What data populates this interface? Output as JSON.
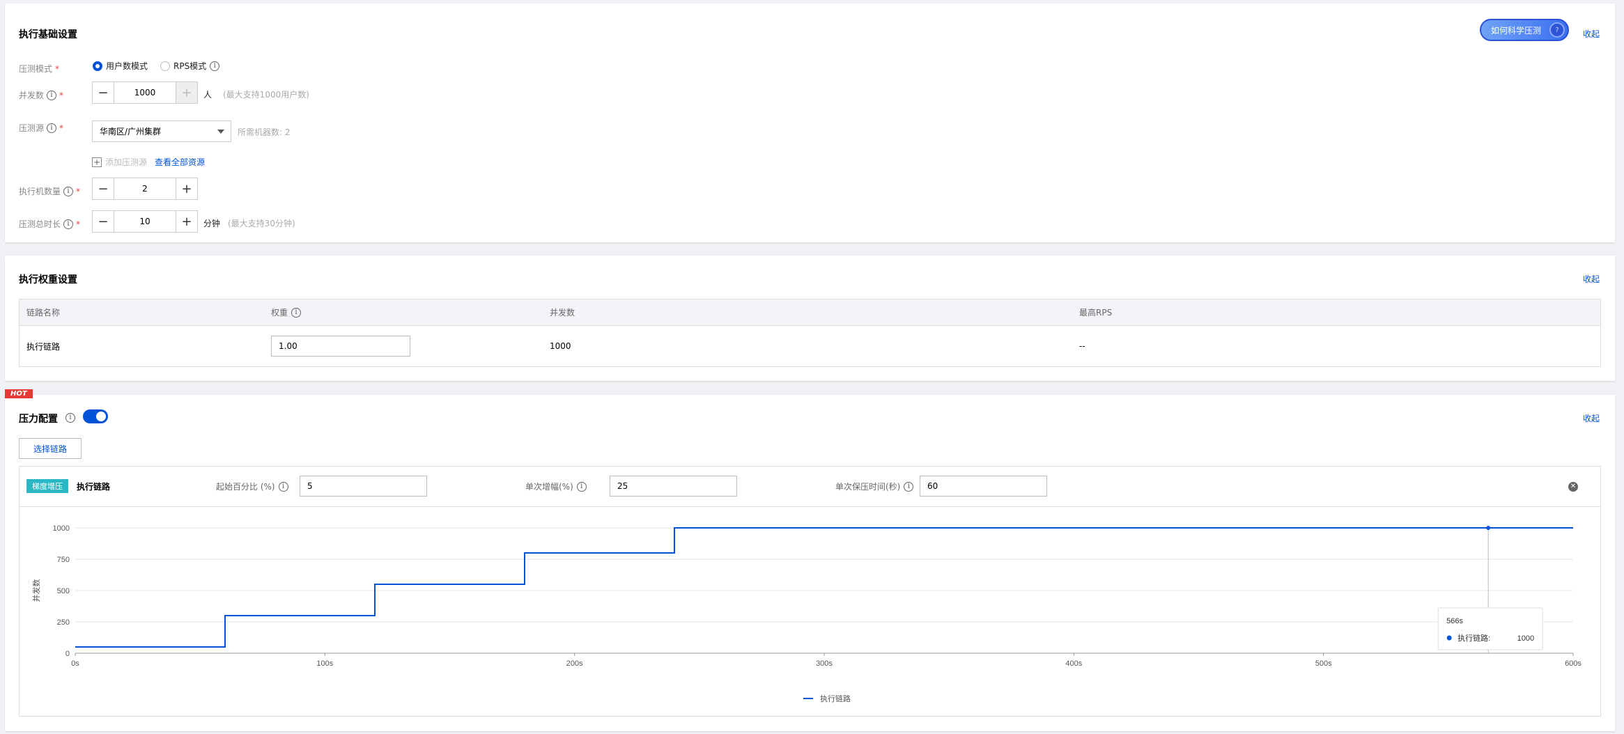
{
  "basic": {
    "title": "执行基础设置",
    "collapse": "收起",
    "science_button": "如何科学压测",
    "mode_label": "压测模式",
    "required_mark": "*",
    "modes": [
      "用户数模式",
      "RPS模式"
    ],
    "concurrency": {
      "label": "并发数",
      "value": "1000",
      "unit": "人",
      "hint": "(最大支持1000用户数)"
    },
    "source": {
      "label": "压测源",
      "value": "华南区/广州集群",
      "machines": "所需机器数: 2"
    },
    "add_source": "添加压测源",
    "view_all": "查看全部资源",
    "machine_count": {
      "label": "执行机数量",
      "value": "2"
    },
    "duration": {
      "label": "压测总时长",
      "value": "10",
      "unit": "分钟",
      "hint": "(最大支持30分钟)"
    }
  },
  "weight": {
    "title": "执行权重设置",
    "collapse": "收起",
    "headers": [
      "链路名称",
      "权重",
      "并发数",
      "最高RPS"
    ],
    "row": {
      "name": "执行链路",
      "weight": "1.00",
      "concurrency": "1000",
      "max_rps": "--"
    }
  },
  "pressure": {
    "hot": "HOT",
    "title": "压力配置",
    "collapse": "收起",
    "select_chain": "选择链路",
    "tag": "梯度增压",
    "chain": "执行链路",
    "start_label": "起始百分比 (%)",
    "start_value": "5",
    "step_label": "单次增幅(%)",
    "step_value": "25",
    "hold_label": "单次保压时间(秒)",
    "hold_value": "60"
  },
  "chart_data": {
    "type": "line",
    "ylabel": "并发数",
    "xlabel": "",
    "x_ticks": [
      "0s",
      "100s",
      "200s",
      "300s",
      "400s",
      "500s",
      "600s"
    ],
    "y_ticks": [
      "0",
      "250",
      "500",
      "750",
      "1000"
    ],
    "xlim": [
      0,
      600
    ],
    "ylim": [
      0,
      1000
    ],
    "series": [
      {
        "name": "执行链路",
        "color": "#0052d9",
        "step": true,
        "points": [
          [
            0,
            50
          ],
          [
            60,
            50
          ],
          [
            60,
            300
          ],
          [
            120,
            300
          ],
          [
            120,
            550
          ],
          [
            180,
            550
          ],
          [
            180,
            800
          ],
          [
            240,
            800
          ],
          [
            240,
            1000
          ],
          [
            600,
            1000
          ]
        ]
      }
    ],
    "tooltip": {
      "x": 566,
      "title": "566s",
      "series": "执行链路:",
      "value": "1000"
    },
    "legend": "bottom-center"
  }
}
